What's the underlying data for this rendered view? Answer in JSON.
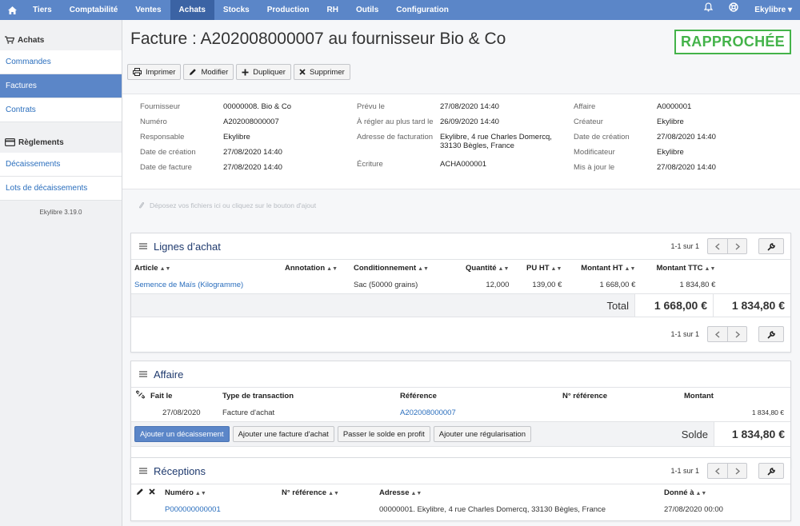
{
  "nav": {
    "items": [
      "Tiers",
      "Comptabilité",
      "Ventes",
      "Achats",
      "Stocks",
      "Production",
      "RH",
      "Outils",
      "Configuration"
    ],
    "active": "Achats",
    "user": "Ekylibre ▾"
  },
  "sidebar": {
    "section1": "Achats",
    "items1": [
      "Commandes",
      "Factures",
      "Contrats"
    ],
    "section2": "Règlements",
    "items2": [
      "Décaissements",
      "Lots de décaissements"
    ],
    "version": "Ekylibre 3.19.0"
  },
  "page": {
    "title": "Facture : A202008000007 au fournisseur Bio & Co",
    "status": "RAPPROCHÉE"
  },
  "toolbar": {
    "print": "Imprimer",
    "edit": "Modifier",
    "duplicate": "Dupliquer",
    "delete": "Supprimer"
  },
  "info": {
    "col1": [
      {
        "label": "Fournisseur",
        "value": "00000008. Bio & Co"
      },
      {
        "label": "Numéro",
        "value": "A202008000007"
      },
      {
        "label": "Responsable",
        "value": "Ekylibre"
      },
      {
        "label": "Date de création",
        "value": "27/08/2020 14:40"
      },
      {
        "label": "Date de facture",
        "value": "27/08/2020 14:40"
      }
    ],
    "col2": [
      {
        "label": "Prévu le",
        "value": "27/08/2020 14:40"
      },
      {
        "label": "À régler au plus tard le",
        "value": "26/09/2020 14:40"
      },
      {
        "label": "Adresse de facturation",
        "value": "Ekylibre, 4 rue Charles Domercq,",
        "value2": "33130 Bègles, France"
      },
      {
        "label": "Écriture",
        "value": "ACHA000001"
      }
    ],
    "col3": [
      {
        "label": "Affaire",
        "value": "A0000001"
      },
      {
        "label": "Créateur",
        "value": "Ekylibre"
      },
      {
        "label": "Date de création",
        "value": "27/08/2020 14:40"
      },
      {
        "label": "Modificateur",
        "value": "Ekylibre"
      },
      {
        "label": "Mis à jour le",
        "value": "27/08/2020 14:40"
      }
    ]
  },
  "dropzone": "Déposez vos fichiers ici ou cliquez sur le bouton d'ajout",
  "lines": {
    "title": "Lignes d’achat",
    "pager": "1-1 sur 1",
    "columns": [
      "Article",
      "Annotation",
      "Conditionnement",
      "Quantité",
      "PU HT",
      "Montant HT",
      "Montant TTC"
    ],
    "row": {
      "article": "Semence de Maïs (Kilogramme)",
      "annotation": "",
      "packaging": "Sac (50000 grains)",
      "quantity": "12,000",
      "unit_price": "139,00 €",
      "amount_ht": "1 668,00 €",
      "amount_ttc": "1 834,80 €"
    },
    "total_label": "Total",
    "total_ht": "1 668,00 €",
    "total_ttc": "1 834,80 €"
  },
  "affair": {
    "title": "Affaire",
    "columns": [
      "Fait le",
      "Type de transaction",
      "Référence",
      "N° référence",
      "Montant"
    ],
    "row": {
      "date": "27/08/2020",
      "type": "Facture d'achat",
      "reference": "A202008000007",
      "ref_number": "",
      "amount": "1 834,80 €"
    },
    "buttons": [
      "Ajouter un décaissement",
      "Ajouter une facture d'achat",
      "Passer le solde en profit",
      "Ajouter une régularisation"
    ],
    "balance_label": "Solde",
    "balance": "1 834,80 €"
  },
  "receptions": {
    "title": "Réceptions",
    "pager": "1-1 sur 1",
    "columns": [
      "Numéro",
      "N° référence",
      "Adresse",
      "Donné à"
    ],
    "row": {
      "number": "P000000000001",
      "ref": "",
      "address": "00000001. Ekylibre, 4 rue Charles Domercq, 33130 Bègles, France",
      "given_at": "27/08/2020 00:00"
    }
  }
}
